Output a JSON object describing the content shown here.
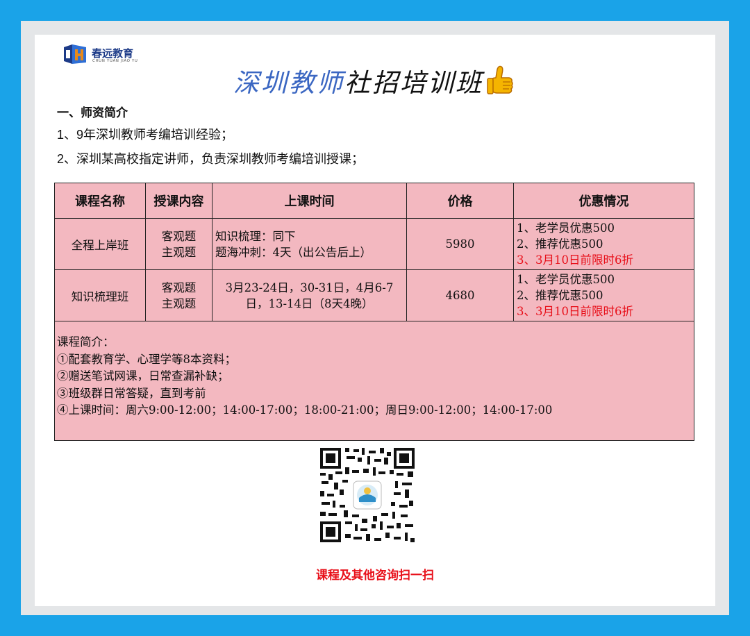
{
  "logo": {
    "name": "春远教育",
    "subtitle": "CHUN YUAN JIAO YU"
  },
  "title": {
    "part1": "深圳教师",
    "part2": "社招培训班"
  },
  "intro": {
    "heading": "一、师资简介",
    "line1": "1、9年深圳教师考编培训经验；",
    "line2": "2、深圳某高校指定讲师，负责深圳教师考编培训授课；"
  },
  "table": {
    "headers": [
      "课程名称",
      "授课内容",
      "上课时间",
      "价格",
      "优惠情况"
    ],
    "rows": [
      {
        "name": "全程上岸班",
        "content": [
          "客观题",
          "主观题"
        ],
        "time": [
          "知识梳理：同下",
          "题海冲刺：4天（出公告后上）"
        ],
        "price": "5980",
        "discount": [
          "1、老学员优惠500",
          "2、推荐优惠500",
          "3、3月10日前限时6折"
        ]
      },
      {
        "name": "知识梳理班",
        "content": [
          "客观题",
          "主观题"
        ],
        "time": [
          "3月23-24日，30-31日，4月6-7",
          "日，13-14日（8天4晚）"
        ],
        "price": "4680",
        "discount": [
          "1、老学员优惠500",
          "2、推荐优惠500",
          "3、3月10日前限时6折"
        ]
      }
    ],
    "notes": [
      "课程简介：",
      "①配套教育学、心理学等8本资料；",
      "②赠送笔试网课，日常查漏补缺；",
      "③班级群日常答疑，直到考前",
      "④上课时间：周六9:00-12:00；14:00-17:00；18:00-21:00；周日9:00-12:00；14:00-17:00"
    ]
  },
  "qr": {
    "caption": "课程及其他咨询扫一扫"
  },
  "colors": {
    "frame": "#1aa3e8",
    "table_bg": "#f3b8c0",
    "highlight": "#e8101a",
    "title_blue": "#3b67c2"
  }
}
